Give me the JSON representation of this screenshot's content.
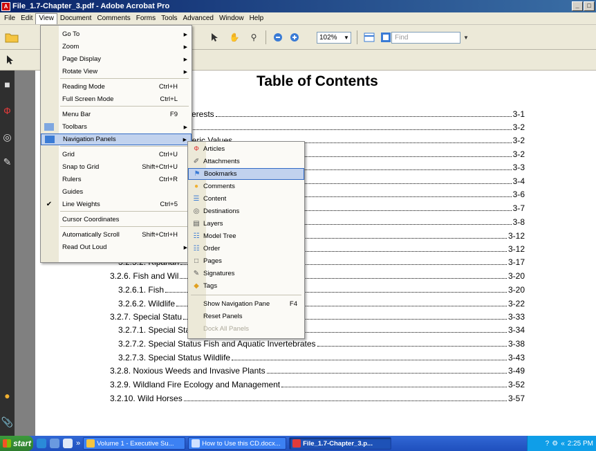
{
  "window": {
    "title": "File_1.7-Chapter_3.pdf - Adobe Acrobat Pro",
    "controls": [
      "_",
      "□"
    ]
  },
  "menubar": [
    "File",
    "Edit",
    "View",
    "Document",
    "Comments",
    "Forms",
    "Tools",
    "Advanced",
    "Window",
    "Help"
  ],
  "toolbar": {
    "zoom": "102%",
    "find_placeholder": "Find"
  },
  "document": {
    "title": "Table of Contents",
    "entries": [
      {
        "text": "nterests",
        "page": "3-1"
      },
      {
        "text": "",
        "page": "3-2"
      },
      {
        "text": "rberic Values",
        "page": "3-2"
      },
      {
        "text": "",
        "page": "3-2"
      },
      {
        "text": "",
        "page": "3-3"
      },
      {
        "text": "",
        "page": "3-4"
      },
      {
        "text": "",
        "page": "3-6"
      },
      {
        "text": "",
        "page": "3-7"
      },
      {
        "text": "",
        "page": "3-8"
      },
      {
        "text": "",
        "page": "3-12"
      },
      {
        "text": "",
        "page": "3-12"
      },
      {
        "text": "3.2.5.2. Riparian",
        "page": "3-17"
      },
      {
        "text": "3.2.6. Fish and Wil",
        "page": "3-20"
      },
      {
        "text": "3.2.6.1. Fish",
        "page": "3-20"
      },
      {
        "text": "3.2.6.2. Wildlife",
        "page": "3-22"
      },
      {
        "text": "3.2.7. Special Statu",
        "page": "3-33"
      },
      {
        "text": "3.2.7.1. Special Status Plants",
        "page": "3-34"
      },
      {
        "text": "3.2.7.2. Special Status Fish and Aquatic Invertebrates",
        "page": "3-38"
      },
      {
        "text": "3.2.7.3. Special Status Wildlife",
        "page": "3-43"
      },
      {
        "text": "3.2.8. Noxious Weeds and Invasive Plants",
        "page": "3-49"
      },
      {
        "text": "3.2.9. Wildland Fire Ecology and Management",
        "page": "3-52"
      },
      {
        "text": "3.2.10. Wild Horses",
        "page": "3-57"
      }
    ]
  },
  "view_menu": {
    "items": [
      {
        "label": "Go To",
        "shortcut": "",
        "submenu": true
      },
      {
        "label": "Zoom",
        "shortcut": "",
        "submenu": true
      },
      {
        "label": "Page Display",
        "shortcut": "",
        "submenu": true
      },
      {
        "label": "Rotate View",
        "shortcut": "",
        "submenu": true
      },
      {
        "label": "Reading Mode",
        "shortcut": "Ctrl+H",
        "submenu": false
      },
      {
        "label": "Full Screen Mode",
        "shortcut": "Ctrl+L",
        "submenu": false
      },
      {
        "label": "Menu Bar",
        "shortcut": "F9",
        "submenu": false
      },
      {
        "label": "Toolbars",
        "shortcut": "",
        "submenu": true
      },
      {
        "label": "Navigation Panels",
        "shortcut": "",
        "submenu": true,
        "highlighted": true
      },
      {
        "label": "Grid",
        "shortcut": "Ctrl+U",
        "submenu": false
      },
      {
        "label": "Snap to Grid",
        "shortcut": "Shift+Ctrl+U",
        "submenu": false
      },
      {
        "label": "Rulers",
        "shortcut": "Ctrl+R",
        "submenu": false
      },
      {
        "label": "Guides",
        "shortcut": "",
        "submenu": false
      },
      {
        "label": "Line Weights",
        "shortcut": "Ctrl+5",
        "submenu": false,
        "checked": true
      },
      {
        "label": "Cursor Coordinates",
        "shortcut": "",
        "submenu": false
      },
      {
        "label": "Automatically Scroll",
        "shortcut": "Shift+Ctrl+H",
        "submenu": false
      },
      {
        "label": "Read Out Loud",
        "shortcut": "",
        "submenu": true
      }
    ]
  },
  "nav_submenu": {
    "items": [
      {
        "label": "Articles",
        "icon": "articles-icon"
      },
      {
        "label": "Attachments",
        "icon": "paperclip-icon"
      },
      {
        "label": "Bookmarks",
        "icon": "bookmark-icon",
        "highlighted": true
      },
      {
        "label": "Comments",
        "icon": "speech-bubble-icon"
      },
      {
        "label": "Content",
        "icon": "content-icon"
      },
      {
        "label": "Destinations",
        "icon": "target-icon"
      },
      {
        "label": "Layers",
        "icon": "layers-icon"
      },
      {
        "label": "Model Tree",
        "icon": "tree-icon"
      },
      {
        "label": "Order",
        "icon": "order-icon"
      },
      {
        "label": "Pages",
        "icon": "pages-icon"
      },
      {
        "label": "Signatures",
        "icon": "signature-icon"
      },
      {
        "label": "Tags",
        "icon": "tag-icon"
      },
      {
        "label": "Show Navigation Pane",
        "shortcut": "F4"
      },
      {
        "label": "Reset Panels"
      },
      {
        "label": "Dock All Panels",
        "disabled": true
      }
    ]
  },
  "taskbar": {
    "start": "start",
    "overflow": "»",
    "tasks": [
      "Volume 1 - Executive Su...",
      "How to Use this CD.docx...",
      "File_1.7-Chapter_3.p..."
    ],
    "clock": "2:25 PM"
  }
}
